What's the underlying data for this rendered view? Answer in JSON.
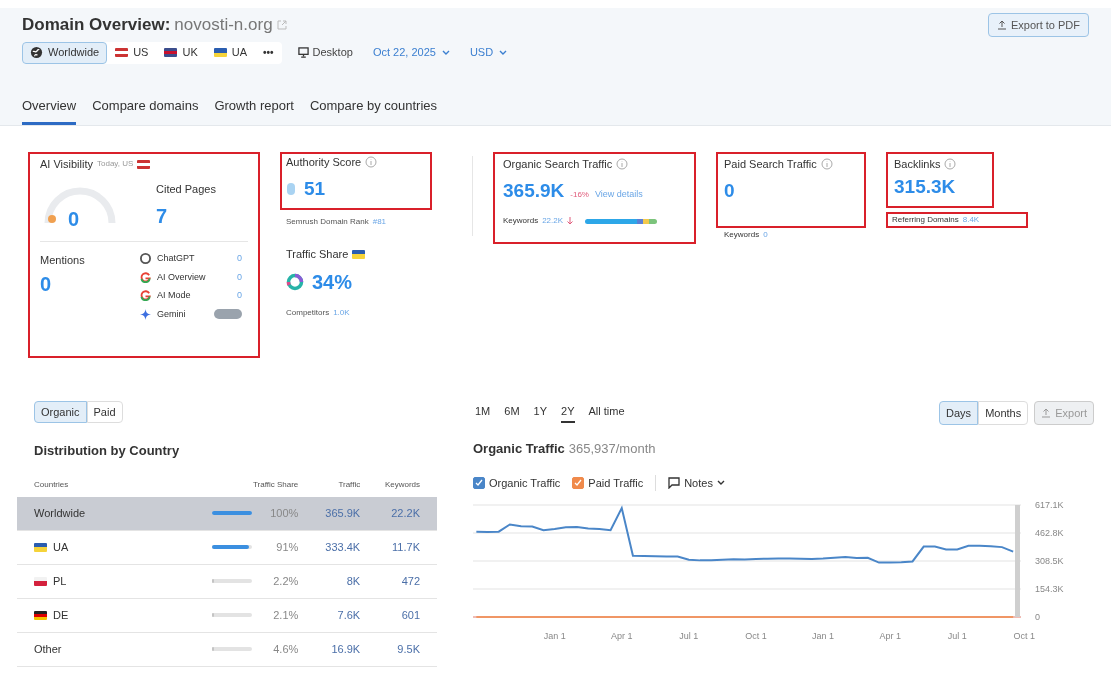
{
  "header": {
    "title": "Domain Overview:",
    "domain": "novosti-n.org",
    "export_button": "Export to PDF",
    "databases": [
      {
        "label": "Worldwide",
        "kind": "globe",
        "selected": true
      },
      {
        "label": "US",
        "kind": "flag",
        "selected": false
      },
      {
        "label": "UK",
        "kind": "flag",
        "selected": false
      },
      {
        "label": "UA",
        "kind": "flag",
        "selected": false
      }
    ],
    "more": "•••",
    "device": "Desktop",
    "date": "Oct 22, 2025",
    "currency": "USD"
  },
  "tabs": [
    {
      "label": "Overview",
      "selected": true
    },
    {
      "label": "Compare domains",
      "selected": false
    },
    {
      "label": "Growth report",
      "selected": false
    },
    {
      "label": "Compare by countries",
      "selected": false
    }
  ],
  "ai_visibility": {
    "title": "AI Visibility",
    "subtitle": "Today, US",
    "highlighted": true,
    "score": "0",
    "cited_label": "Cited Pages",
    "cited_value": "7",
    "mentions_label": "Mentions",
    "mentions_value": "0",
    "platforms": [
      {
        "name": "ChatGPT",
        "kind": "chatgpt",
        "value": "0"
      },
      {
        "name": "AI Overview",
        "kind": "google",
        "value": "0"
      },
      {
        "name": "AI Mode",
        "kind": "google",
        "value": "0"
      },
      {
        "name": "Gemini",
        "kind": "gemini"
      }
    ]
  },
  "authority": {
    "title": "Authority Score",
    "value": "51",
    "highlighted": true,
    "rank_label": "Semrush Domain Rank",
    "rank_value": "#81"
  },
  "traffic_share": {
    "title": "Traffic Share",
    "value": "34%",
    "competitors_label": "Competitors",
    "competitors_value": "1.0K"
  },
  "organic": {
    "title": "Organic Search Traffic",
    "value": "365.9K",
    "change": "-16%",
    "link": "View details",
    "keywords_label": "Keywords",
    "keywords_value": "22.2K",
    "highlighted": true
  },
  "paid": {
    "title": "Paid Search Traffic",
    "value": "0",
    "keywords_label": "Keywords",
    "keywords_value": "0",
    "highlighted": true
  },
  "backlinks": {
    "title": "Backlinks",
    "value": "315.3K",
    "highlighted": true,
    "referring_label": "Referring Domains",
    "referring_value": "8.4K",
    "referring_highlighted": true
  },
  "distribution": {
    "toggle": [
      {
        "label": "Organic",
        "selected": true
      },
      {
        "label": "Paid",
        "selected": false
      }
    ],
    "title": "Distribution by Country",
    "columns": [
      "Countries",
      "Traffic Share",
      "Traffic",
      "Keywords"
    ],
    "rows": [
      {
        "kind": "total",
        "country": "Worldwide",
        "share": "100%",
        "level": 1,
        "color": "#3b8fe0",
        "traffic": "365.9K",
        "keywords": "22.2K",
        "selected": true
      },
      {
        "kind": "country",
        "country": "UA",
        "share": "91%",
        "level": 0.91,
        "color": "#3b8fe0",
        "traffic": "333.4K",
        "keywords": "11.7K",
        "selected": false
      },
      {
        "kind": "country",
        "country": "PL",
        "share": "2.2%",
        "level": 0.022,
        "color": "#c4c4c4",
        "traffic": "8K",
        "keywords": "472",
        "selected": false
      },
      {
        "kind": "country",
        "country": "DE",
        "share": "2.1%",
        "level": 0.021,
        "color": "#c4c4c4",
        "traffic": "7.6K",
        "keywords": "601",
        "selected": false
      },
      {
        "kind": "total",
        "country": "Other",
        "share": "4.6%",
        "level": 0.046,
        "color": "#c4c4c4",
        "traffic": "16.9K",
        "keywords": "9.5K",
        "selected": false
      }
    ]
  },
  "trend": {
    "ranges": [
      {
        "label": "1M",
        "selected": false
      },
      {
        "label": "6M",
        "selected": false
      },
      {
        "label": "1Y",
        "selected": false
      },
      {
        "label": "2Y",
        "selected": true
      },
      {
        "label": "All time",
        "selected": false
      }
    ],
    "units": [
      {
        "label": "Days",
        "selected": true
      },
      {
        "label": "Months",
        "selected": false
      }
    ],
    "export": "Export",
    "title": "Organic Traffic",
    "subtitle": "365,937/month",
    "legend": [
      {
        "checked": true
      },
      {
        "checked": true
      }
    ],
    "notes": "Notes",
    "chart_data": {
      "type": "line",
      "categories": [
        null,
        null,
        null,
        null,
        null,
        null,
        null,
        "Jan 1",
        null,
        null,
        null,
        null,
        null,
        "Apr 1",
        null,
        null,
        null,
        null,
        null,
        "Jul 1",
        null,
        null,
        null,
        null,
        null,
        "Oct 1",
        null,
        null,
        null,
        null,
        null,
        "Jan 1",
        null,
        null,
        null,
        null,
        null,
        "Apr 1",
        null,
        null,
        null,
        null,
        null,
        "Jul 1",
        null,
        null,
        null,
        null,
        null,
        "Oct 1"
      ],
      "series": [
        {
          "name": "Organic Traffic",
          "color": "#4a86c8",
          "values": [
            470,
            468,
            470,
            510,
            500,
            498,
            478,
            485,
            495,
            496,
            488,
            485,
            478,
            600,
            338,
            336,
            335,
            334,
            333,
            315,
            312,
            313,
            316,
            318,
            317,
            320,
            321,
            322,
            323,
            321,
            320,
            322,
            326,
            330,
            325,
            326,
            300,
            300,
            302,
            306,
            388,
            388,
            372,
            372,
            392,
            392,
            390,
            385,
            360,
            null
          ]
        },
        {
          "name": "Paid Traffic",
          "color": "#f08a4b",
          "values": [
            0,
            0,
            0,
            0,
            0,
            0,
            0,
            0,
            0,
            0,
            0,
            0,
            0,
            0,
            0,
            0,
            0,
            0,
            0,
            0,
            0,
            0,
            0,
            0,
            0,
            0,
            0,
            0,
            0,
            0,
            0,
            0,
            0,
            0,
            0,
            0,
            0,
            0,
            0,
            0,
            0,
            0,
            0,
            0,
            0,
            0,
            0,
            0,
            0,
            null
          ]
        }
      ],
      "ylim": [
        0,
        617.1
      ],
      "grid": true,
      "yticks": [
        {
          "value": 617.1,
          "label": "617.1K"
        },
        {
          "value": 462.8,
          "label": "462.8K"
        },
        {
          "value": 308.5,
          "label": "308.5K"
        },
        {
          "value": 154.3,
          "label": "154.3K"
        },
        {
          "value": 0,
          "label": "0"
        }
      ]
    }
  }
}
